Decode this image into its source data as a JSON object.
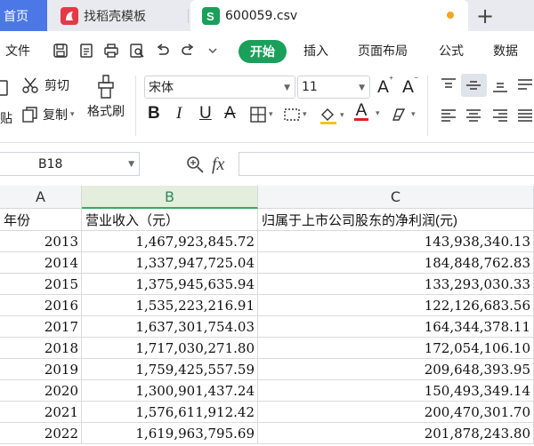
{
  "tabs": {
    "home_label": "首页",
    "docer_label": "找稻壳模板",
    "file_label": "600059.csv",
    "new_tab": "+"
  },
  "menu": {
    "file": "文件",
    "start": "开始",
    "insert": "插入",
    "page_layout": "页面布局",
    "formulas": "公式",
    "data": "数据"
  },
  "ribbon": {
    "cut": "剪切",
    "paste": "粘贴",
    "copy": "复制",
    "format_painter": "格式刷",
    "font_name": "宋体",
    "font_size": "11"
  },
  "formula_bar": {
    "cell_ref": "B18",
    "fx": "fx",
    "value": ""
  },
  "columns": [
    {
      "label": "A",
      "selected": false
    },
    {
      "label": "B",
      "selected": true
    },
    {
      "label": "C",
      "selected": false
    }
  ],
  "header_row": [
    "年份",
    "营业收入（元）",
    "归属于上市公司股东的净利润(元)"
  ],
  "rows": [
    [
      "2013",
      "1,467,923,845.72",
      "143,938,340.13"
    ],
    [
      "2014",
      "1,337,947,725.04",
      "184,848,762.83"
    ],
    [
      "2015",
      "1,375,945,635.94",
      "133,293,030.33"
    ],
    [
      "2016",
      "1,535,223,216.91",
      "122,126,683.56"
    ],
    [
      "2017",
      "1,637,301,754.03",
      "164,344,378.11"
    ],
    [
      "2018",
      "1,717,030,271.80",
      "172,054,106.10"
    ],
    [
      "2019",
      "1,759,425,557.59",
      "209,648,393.95"
    ],
    [
      "2020",
      "1,300,901,437.24",
      "150,493,349.14"
    ],
    [
      "2021",
      "1,576,611,912.42",
      "200,470,301.70"
    ],
    [
      "2022",
      "1,619,963,795.69",
      "201,878,243.80"
    ]
  ],
  "colors": {
    "accent_green": "#1aa05a",
    "home_tab_blue": "#4b78e6",
    "unsaved_dot": "#f5a524",
    "selected_col_header": "#e3eedd"
  }
}
